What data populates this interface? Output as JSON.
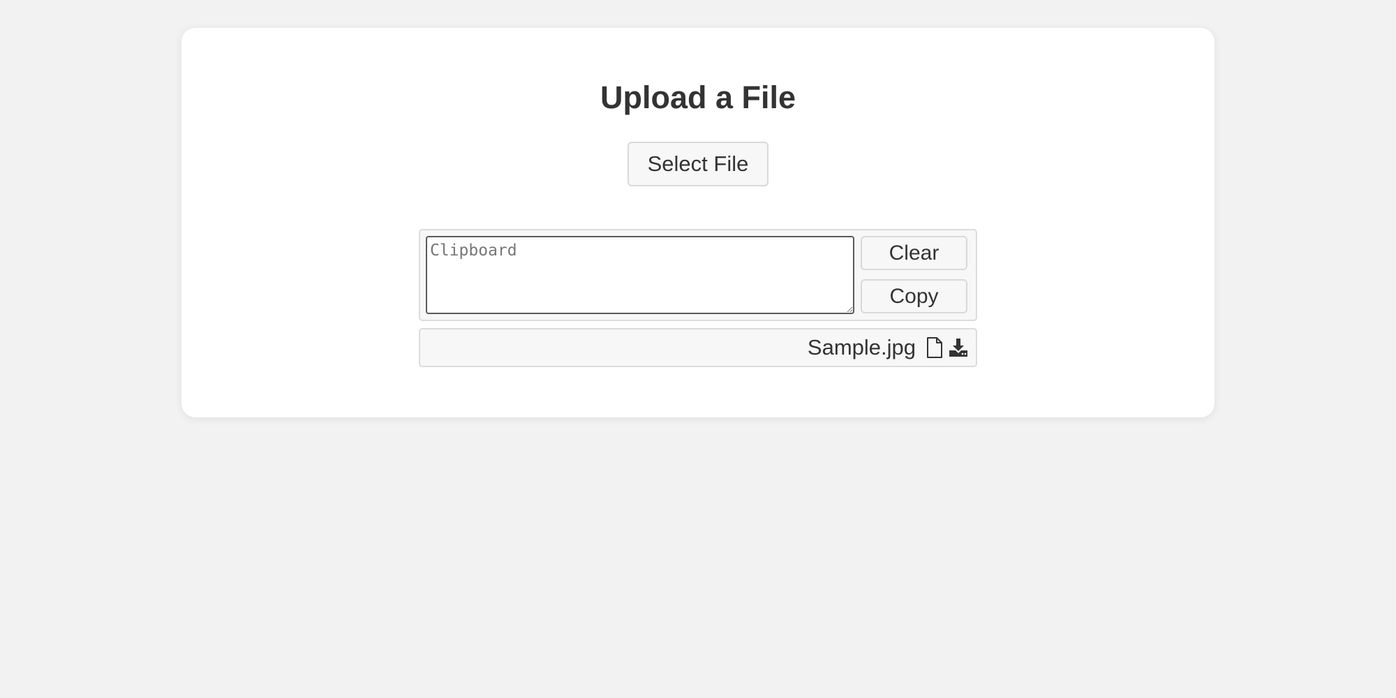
{
  "page": {
    "title": "Upload a File",
    "select_button_label": "Select File"
  },
  "clipboard": {
    "placeholder": "Clipboard",
    "value": "",
    "clear_label": "Clear",
    "copy_label": "Copy"
  },
  "file": {
    "name": "Sample.jpg",
    "file_icon": "file-icon",
    "download_icon": "download-icon"
  },
  "colors": {
    "background": "#f2f2f2",
    "card": "#ffffff",
    "text": "#333333",
    "button_bg": "#f7f7f7",
    "border": "#d9d9d9"
  }
}
